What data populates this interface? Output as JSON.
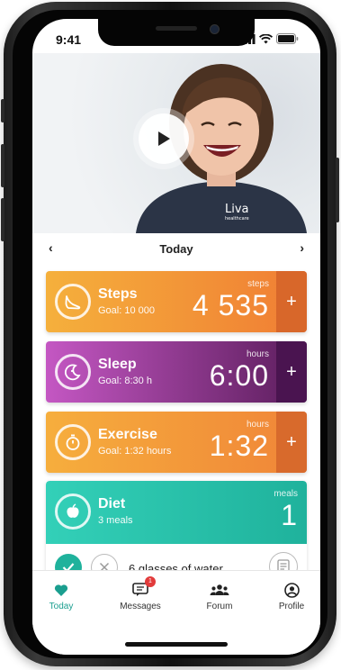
{
  "status": {
    "time": "9:41"
  },
  "hero": {
    "shirt_text_1": "Liva",
    "shirt_text_2": "healthcare"
  },
  "datebar": {
    "title": "Today",
    "prev": "‹",
    "next": "›"
  },
  "cards": {
    "steps": {
      "name": "Steps",
      "goal": "Goal: 10 000",
      "unit": "steps",
      "value": "4 535",
      "plus": "+"
    },
    "sleep": {
      "name": "Sleep",
      "goal": "Goal: 8:30 h",
      "unit": "hours",
      "value": "6:00",
      "plus": "+"
    },
    "exercise": {
      "name": "Exercise",
      "goal": "Goal: 1:32 hours",
      "unit": "hours",
      "value": "1:32",
      "plus": "+"
    },
    "diet": {
      "name": "Diet",
      "goal": "3 meals",
      "unit": "meals",
      "value": "1"
    }
  },
  "water": {
    "label": "6 glasses of water"
  },
  "tabs": {
    "today": "Today",
    "messages": "Messages",
    "messages_badge": "1",
    "forum": "Forum",
    "profile": "Profile"
  },
  "colors": {
    "steps": [
      "#f0a13a",
      "#f07c35"
    ],
    "sleep": [
      "#b04fb0",
      "#5b1d5c"
    ],
    "exercise": [
      "#f2a13b",
      "#f0843a"
    ],
    "diet": [
      "#2fcab3",
      "#1fb29c"
    ],
    "accent_teal": "#1a9e8f",
    "badge": "#e23b3b"
  }
}
